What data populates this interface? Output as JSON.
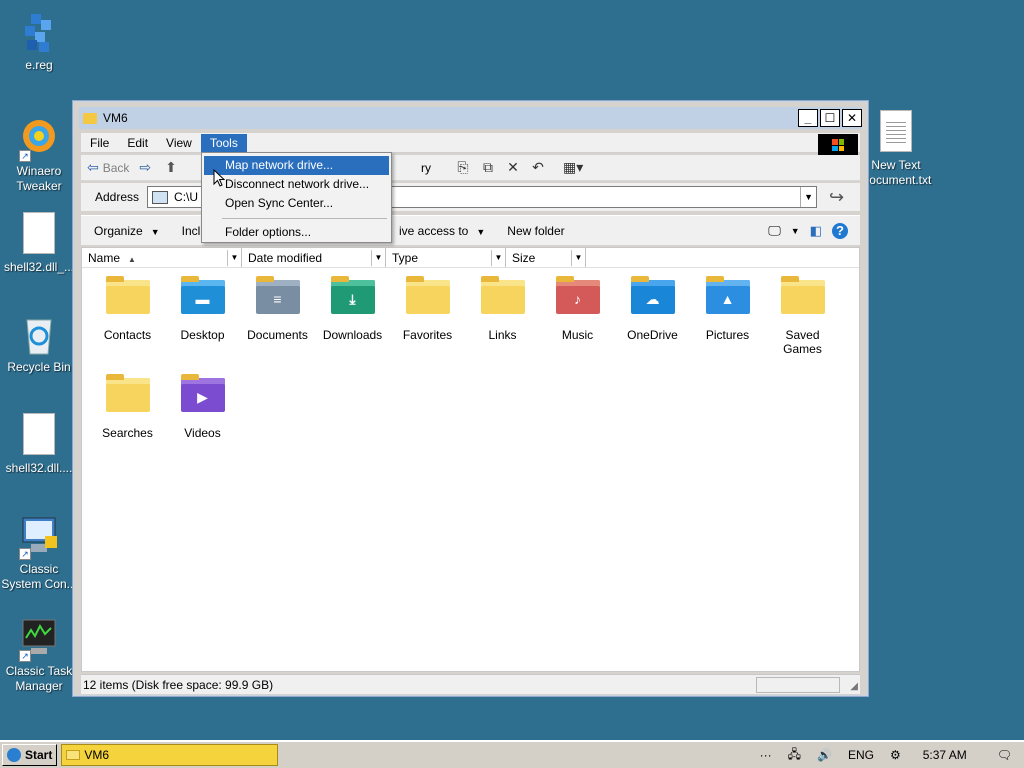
{
  "desktop": {
    "icons": [
      {
        "label": "e.reg"
      },
      {
        "label": "Winaero Tweaker"
      },
      {
        "label": "shell32.dll_..."
      },
      {
        "label": "Recycle Bin"
      },
      {
        "label": "shell32.dll...."
      },
      {
        "label": "Classic System Con..."
      },
      {
        "label": "Classic Task Manager"
      },
      {
        "label": "New Text Document.txt"
      }
    ]
  },
  "window": {
    "title": "VM6",
    "menu": [
      "File",
      "Edit",
      "View",
      "Tools"
    ],
    "toolbar": {
      "back": "Back",
      "history_partial": "ry"
    },
    "address": {
      "label": "Address",
      "value": "C:\\U"
    },
    "commands": {
      "organize": "Organize",
      "include_partial": "Inclu",
      "share_partial": "ive access to",
      "new_folder": "New folder"
    },
    "columns": [
      "Name",
      "Date modified",
      "Type",
      "Size"
    ],
    "items": [
      {
        "label": "Contacts",
        "icon": "folder-icon"
      },
      {
        "label": "Desktop",
        "icon": "desktop-folder-icon"
      },
      {
        "label": "Documents",
        "icon": "documents-folder-icon"
      },
      {
        "label": "Downloads",
        "icon": "downloads-folder-icon"
      },
      {
        "label": "Favorites",
        "icon": "folder-icon"
      },
      {
        "label": "Links",
        "icon": "folder-icon"
      },
      {
        "label": "Music",
        "icon": "music-folder-icon"
      },
      {
        "label": "OneDrive",
        "icon": "onedrive-folder-icon"
      },
      {
        "label": "Pictures",
        "icon": "pictures-folder-icon"
      },
      {
        "label": "Saved Games",
        "icon": "folder-icon"
      },
      {
        "label": "Searches",
        "icon": "folder-icon"
      },
      {
        "label": "Videos",
        "icon": "videos-folder-icon"
      }
    ],
    "status": "12 items (Disk free space: 99.9 GB)"
  },
  "tools_menu": {
    "items": [
      "Map network drive...",
      "Disconnect network drive...",
      "Open Sync Center...",
      "Folder options..."
    ],
    "highlighted_index": 0
  },
  "taskbar": {
    "start": "Start",
    "task": "VM6",
    "tray": {
      "overflow": "···",
      "lang": "ENG",
      "time": "5:37 AM"
    }
  },
  "colors": {
    "desktop": "#2e6e8e",
    "highlight": "#2a6fbd",
    "taskbar_active": "#f4d33c"
  }
}
